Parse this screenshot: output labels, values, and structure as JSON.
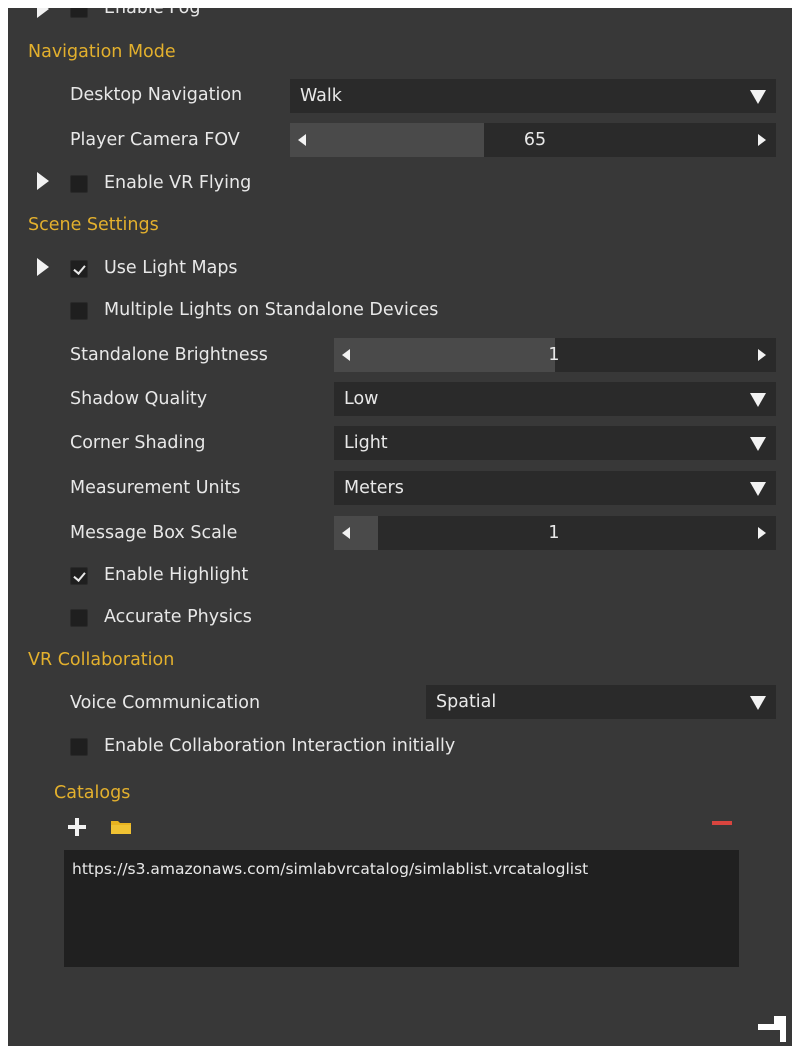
{
  "fog": {
    "label": "Enable Fog"
  },
  "navigation": {
    "heading": "Navigation Mode",
    "desktop_label": "Desktop Navigation",
    "desktop_value": "Walk",
    "fov_label": "Player Camera FOV",
    "fov_value": "65",
    "fov_level": 0.4,
    "vr_flying_label": "Enable VR Flying",
    "vr_flying_checked": false
  },
  "scene": {
    "heading": "Scene Settings",
    "light_maps_label": "Use Light Maps",
    "light_maps_checked": true,
    "multi_lights_label": "Multiple Lights on Standalone Devices",
    "multi_lights_checked": false,
    "brightness_label": "Standalone Brightness",
    "brightness_value": "1",
    "brightness_level": 0.5,
    "shadow_label": "Shadow Quality",
    "shadow_value": "Low",
    "corner_label": "Corner Shading",
    "corner_value": "Light",
    "units_label": "Measurement Units",
    "units_value": "Meters",
    "msgbox_label": "Message Box Scale",
    "msgbox_value": "1",
    "msgbox_level": 0.1,
    "highlight_label": "Enable Highlight",
    "highlight_checked": true,
    "physics_label": "Accurate Physics",
    "physics_checked": false
  },
  "collab": {
    "heading": "VR Collaboration",
    "voice_label": "Voice Communication",
    "voice_value": "Spatial",
    "interaction_label": "Enable Collaboration Interaction initially",
    "interaction_checked": false
  },
  "catalogs": {
    "heading": "Catalogs",
    "items": [
      "https://s3.amazonaws.com/simlabvrcatalog/simlablist.vrcataloglist"
    ]
  },
  "colors": {
    "panel_bg": "#383838",
    "accent": "#e3b02d",
    "remove": "#d9453f",
    "folder": "#e8b320"
  },
  "icons": {
    "add": "plus-icon",
    "folder": "folder-icon",
    "remove": "minus-icon",
    "expand": "triangle-right-icon",
    "dropdown": "triangle-down-icon",
    "resize": "resize-grip-icon"
  }
}
